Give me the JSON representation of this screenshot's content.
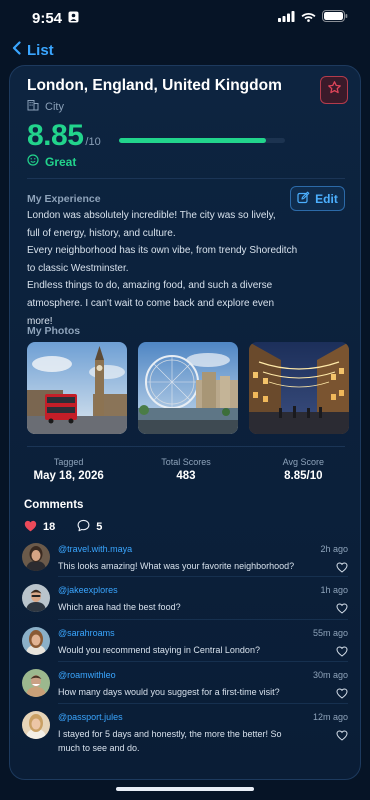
{
  "status_bar": {
    "time": "9:54"
  },
  "nav": {
    "back_label": "List"
  },
  "place": {
    "title": "London, England, United Kingdom",
    "category": "City",
    "score": "8.85",
    "score_max": "/10",
    "score_fraction": 0.885,
    "rating_word": "Great"
  },
  "experience": {
    "label": "My Experience",
    "edit_label": "Edit",
    "lines": [
      "London was absolutely incredible! The city was so lively,",
      "full of energy, history, and culture.",
      "Every neighborhood has its own vibe, from trendy Shoreditch",
      "to classic Westminster.",
      "Endless things to do, amazing food, and such a diverse",
      "atmosphere. I can't wait to come back and explore even more!"
    ]
  },
  "photos": {
    "label": "My Photos"
  },
  "stats": [
    {
      "label": "Tagged",
      "value": "May 18, 2026"
    },
    {
      "label": "Total Scores",
      "value": "483"
    },
    {
      "label": "Avg Score",
      "value": "8.85/10"
    }
  ],
  "comments": {
    "title": "Comments",
    "likes": "18",
    "comment_count": "5",
    "items": [
      {
        "handle": "@travel.with.maya",
        "time": "2h ago",
        "text": "This looks amazing! What was your favorite neighborhood?"
      },
      {
        "handle": "@jakeexplores",
        "time": "1h ago",
        "text": "Which area had the best food?"
      },
      {
        "handle": "@sarahroams",
        "time": "55m ago",
        "text": "Would you recommend staying in Central London?"
      },
      {
        "handle": "@roamwithleo",
        "time": "30m ago",
        "text": "How many days would you suggest for a first-time visit?"
      },
      {
        "handle": "@passport.jules",
        "time": "12m ago",
        "text": "I stayed for 5 days and honestly, the more the better! So much to see and do."
      }
    ]
  },
  "colors": {
    "accent_green": "#22d48c",
    "accent_blue": "#3aa6ff",
    "favorite_red": "#e0455a",
    "background": "#061426"
  }
}
